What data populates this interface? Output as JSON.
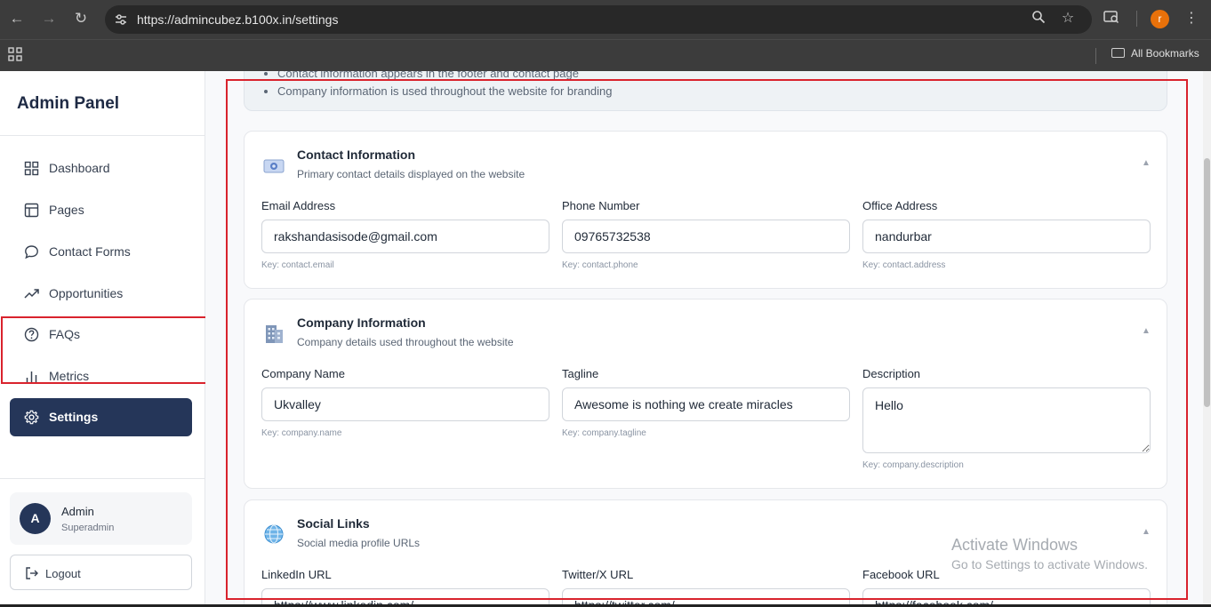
{
  "browser": {
    "url": "https://admincubez.b100x.in/settings",
    "profile_initial": "r",
    "bookmarks_label": "All Bookmarks",
    "icons": [
      "back-icon",
      "forward-icon",
      "reload-icon",
      "site-settings-icon",
      "zoom-icon",
      "star-icon",
      "tab-search-icon",
      "menu-dots-icon",
      "apps-grid-icon",
      "folder-icon"
    ]
  },
  "sidebar": {
    "title": "Admin Panel",
    "items": [
      {
        "label": "Dashboard",
        "icon": "dashboard-grid-icon"
      },
      {
        "label": "Pages",
        "icon": "layout-icon"
      },
      {
        "label": "Contact Forms",
        "icon": "chat-bubble-icon"
      },
      {
        "label": "Opportunities",
        "icon": "trend-icon"
      },
      {
        "label": "FAQs",
        "icon": "help-circle-icon"
      },
      {
        "label": "Metrics",
        "icon": "bar-chart-icon"
      },
      {
        "label": "Settings",
        "icon": "gear-icon",
        "active": true
      }
    ],
    "user": {
      "initial": "A",
      "name": "Admin",
      "role": "Superadmin"
    },
    "logout_label": "Logout"
  },
  "info": {
    "bullets": [
      "Contact information appears in the footer and contact page",
      "Company information is used throughout the website for branding"
    ]
  },
  "sections": {
    "contact": {
      "title": "Contact Information",
      "subtitle": "Primary contact details displayed on the website",
      "icon": "mailbox-icon",
      "fields": [
        {
          "label": "Email Address",
          "value": "rakshandasisode@gmail.com",
          "key": "Key: contact.email"
        },
        {
          "label": "Phone Number",
          "value": "09765732538",
          "key": "Key: contact.phone"
        },
        {
          "label": "Office Address",
          "value": "nandurbar",
          "key": "Key: contact.address"
        }
      ]
    },
    "company": {
      "title": "Company Information",
      "subtitle": "Company details used throughout the website",
      "icon": "building-icon",
      "fields": [
        {
          "label": "Company Name",
          "value": "Ukvalley",
          "key": "Key: company.name"
        },
        {
          "label": "Tagline",
          "value": "Awesome is nothing we create miracles",
          "key": "Key: company.tagline"
        },
        {
          "label": "Description",
          "value": "Hello",
          "key": "Key: company.description"
        }
      ]
    },
    "social": {
      "title": "Social Links",
      "subtitle": "Social media profile URLs",
      "icon": "globe-icon",
      "fields": [
        {
          "label": "LinkedIn URL",
          "value": "https://www.linkedin.com/"
        },
        {
          "label": "Twitter/X URL",
          "value": "https://twitter.com/"
        },
        {
          "label": "Facebook URL",
          "value": "https://facebook.com/"
        }
      ]
    }
  },
  "watermark": {
    "line1": "Activate Windows",
    "line2": "Go to Settings to activate Windows."
  },
  "colors": {
    "sidebar_active": "#253659",
    "highlight_border": "#d9232d",
    "chrome_bg": "#3c3c3c"
  }
}
